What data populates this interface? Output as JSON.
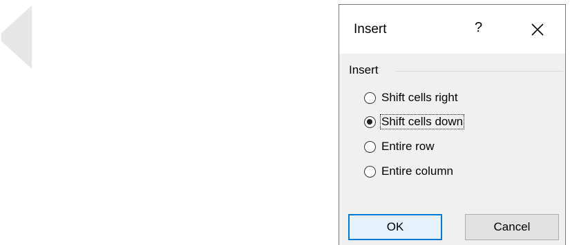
{
  "dialog": {
    "title": "Insert",
    "help_label": "?",
    "close_icon": "close-icon",
    "group_label": "Insert",
    "options": [
      {
        "label": "Shift cells right",
        "checked": false
      },
      {
        "label": "Shift cells down",
        "checked": true
      },
      {
        "label": "Entire row",
        "checked": false
      },
      {
        "label": "Entire column",
        "checked": false
      }
    ],
    "ok_label": "OK",
    "cancel_label": "Cancel"
  },
  "background": {
    "back_icon": "chevron-left-icon"
  },
  "colors": {
    "dialog_bg": "#f0f0f0",
    "titlebar_bg": "#ffffff",
    "ok_border": "#0078d7",
    "ok_bg": "#e5f1fb",
    "chevron": "#e6e6e6"
  }
}
